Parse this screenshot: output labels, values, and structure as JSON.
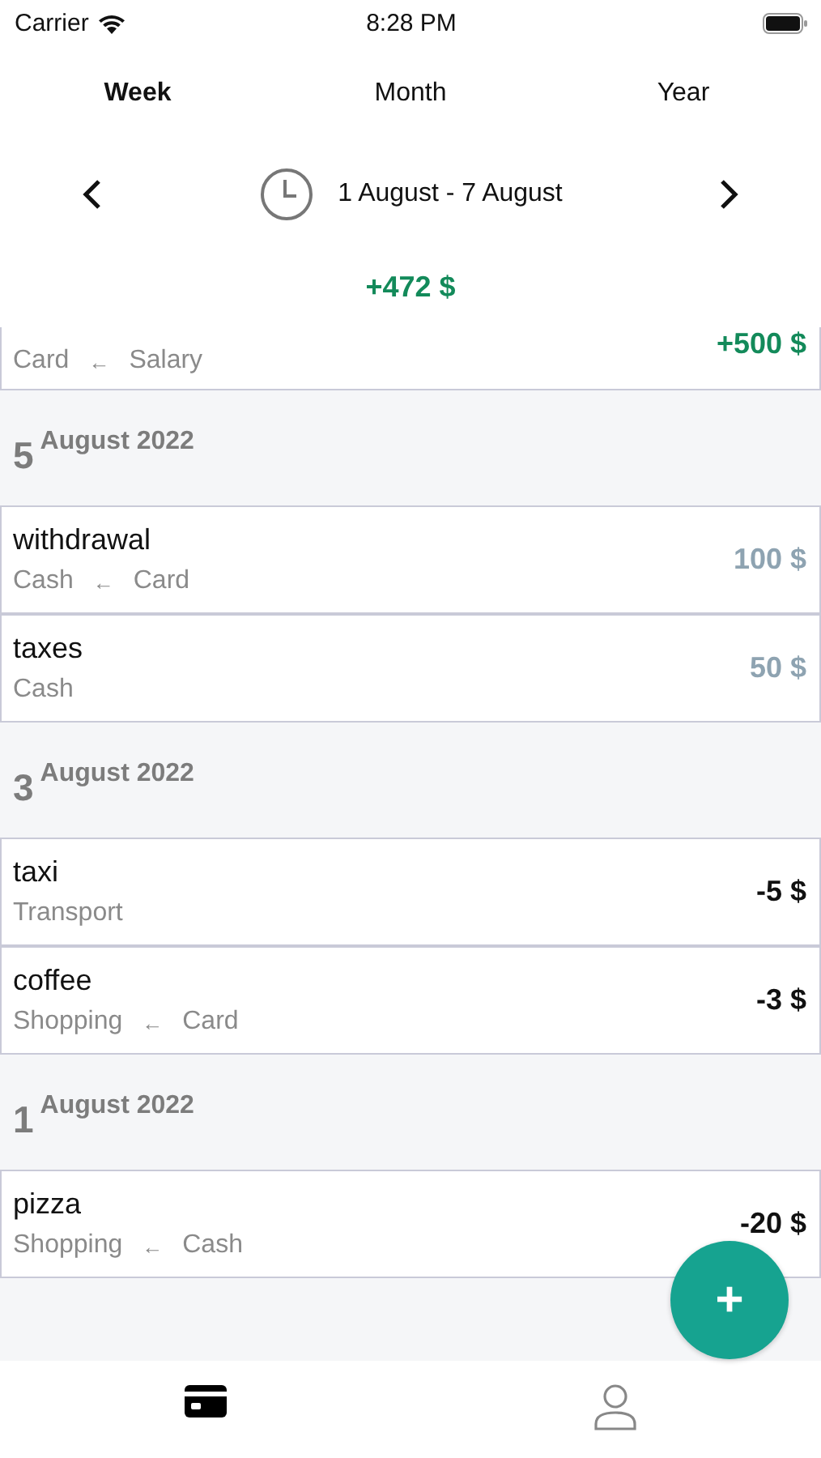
{
  "status_bar": {
    "carrier": "Carrier",
    "time": "8:28 PM"
  },
  "tabs": [
    {
      "label": "Week",
      "selected": true
    },
    {
      "label": "Month",
      "selected": false
    },
    {
      "label": "Year",
      "selected": false
    }
  ],
  "period": {
    "range": "1 August - 7 August",
    "total": "+472 $"
  },
  "partial_entry": {
    "from": "Card",
    "arrow": "←",
    "to": "Salary",
    "amount": "+500 $",
    "kind": "income"
  },
  "groups": [
    {
      "day": "5",
      "month_year": "August 2022",
      "entries": [
        {
          "title": "withdrawal",
          "from": "Cash",
          "arrow": "←",
          "to": "Card",
          "amount": "100 $",
          "kind": "transfer"
        },
        {
          "title": "taxes",
          "from": "Cash",
          "amount": "50 $",
          "kind": "transfer"
        }
      ]
    },
    {
      "day": "3",
      "month_year": "August 2022",
      "entries": [
        {
          "title": "taxi",
          "from": "Transport",
          "amount": "-5 $",
          "kind": "expense"
        },
        {
          "title": "coffee",
          "from": "Shopping",
          "arrow": "←",
          "to": "Card",
          "amount": "-3 $",
          "kind": "expense"
        }
      ]
    },
    {
      "day": "1",
      "month_year": "August 2022",
      "entries": [
        {
          "title": "pizza",
          "from": "Shopping",
          "arrow": "←",
          "to": "Cash",
          "amount": "-20 $",
          "kind": "expense"
        }
      ]
    }
  ],
  "add_button": {
    "label": "+"
  },
  "bottom_nav": [
    {
      "kind": "card",
      "selected": true
    },
    {
      "kind": "profile",
      "selected": false
    }
  ]
}
